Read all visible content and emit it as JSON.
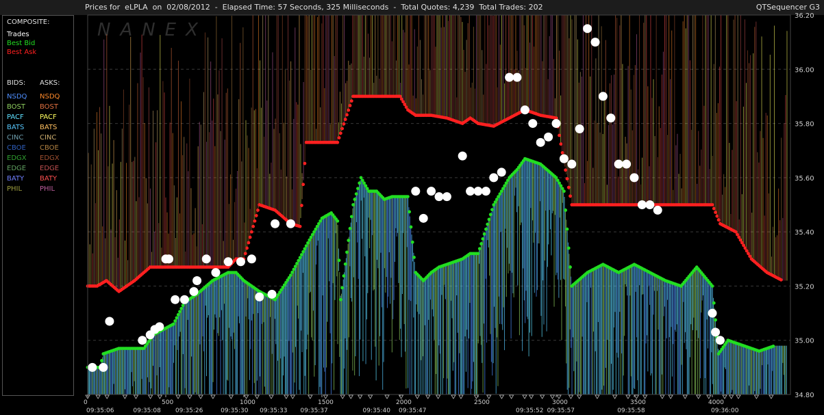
{
  "header": {
    "title": "Prices for  eLPLA  on  02/08/2012  -  Elapsed Time: 57 Seconds, 325 Milliseconds  -  Total Quotes: 4,239  Total Trades: 202",
    "app_name": "QTSequencer G3"
  },
  "watermark": "NANEX",
  "legend": {
    "composite_title": "COMPOSITE:",
    "composite": [
      {
        "label": "Trades",
        "color": "#ffffff"
      },
      {
        "label": "Best Bid",
        "color": "#22dd22"
      },
      {
        "label": "Best Ask",
        "color": "#ff2020"
      }
    ],
    "bids_title": "BIDS:",
    "asks_title": "ASKS:",
    "exchanges": [
      {
        "bid": "NSDQ",
        "ask": "NSDQ",
        "bid_color": "#4f8fff",
        "ask_color": "#ff8a2a"
      },
      {
        "bid": "BOST",
        "ask": "BOST",
        "bid_color": "#8fcf5f",
        "ask_color": "#e07040"
      },
      {
        "bid": "PACF",
        "ask": "PACF",
        "bid_color": "#5fe0ff",
        "ask_color": "#ffff60"
      },
      {
        "bid": "BATS",
        "ask": "BATS",
        "bid_color": "#58c8ff",
        "ask_color": "#ffc060"
      },
      {
        "bid": "CINC",
        "ask": "CINC",
        "bid_color": "#6fa0b0",
        "ask_color": "#d0b070"
      },
      {
        "bid": "CBOE",
        "ask": "CBOE",
        "bid_color": "#2f5fbf",
        "ask_color": "#b08040"
      },
      {
        "bid": "EDGX",
        "ask": "EDGX",
        "bid_color": "#30a030",
        "ask_color": "#a05030"
      },
      {
        "bid": "EDGE",
        "ask": "EDGE",
        "bid_color": "#60a060",
        "ask_color": "#c05050"
      },
      {
        "bid": "BATY",
        "ask": "BATY",
        "bid_color": "#7080ff",
        "ask_color": "#ff5050"
      },
      {
        "bid": "PHIL",
        "ask": "PHIL",
        "bid_color": "#a0a040",
        "ask_color": "#c060a0"
      }
    ]
  },
  "chart_data": {
    "type": "line",
    "ylim": [
      34.8,
      36.2
    ],
    "xlim": [
      0,
      4500
    ],
    "y_ticks": [
      "34.80",
      "35.00",
      "35.20",
      "35.40",
      "35.60",
      "35.80",
      "36.00",
      "36.20"
    ],
    "x_ticks": [
      0,
      500,
      1000,
      1500,
      2000,
      2500,
      3000,
      3500,
      4000
    ],
    "time_labels": [
      {
        "x": 0,
        "label": "09:35:06"
      },
      {
        "x": 300,
        "label": "09:35:08"
      },
      {
        "x": 570,
        "label": "09:35:26"
      },
      {
        "x": 860,
        "label": "09:35:30"
      },
      {
        "x": 1110,
        "label": "09:35:33"
      },
      {
        "x": 1370,
        "label": "09:35:37"
      },
      {
        "x": 1770,
        "label": "09:35:40"
      },
      {
        "x": 2000,
        "label": "09:35:47"
      },
      {
        "x": 2750,
        "label": "09:35:52"
      },
      {
        "x": 2950,
        "label": "09:35:57"
      },
      {
        "x": 3400,
        "label": "09:35:58"
      },
      {
        "x": 4000,
        "label": "09:36:00"
      }
    ],
    "series": [
      {
        "name": "Best Bid",
        "color": "#22dd22",
        "points": [
          [
            0,
            34.9
          ],
          [
            80,
            34.9
          ],
          [
            100,
            34.95
          ],
          [
            200,
            34.97
          ],
          [
            360,
            34.97
          ],
          [
            420,
            35.02
          ],
          [
            550,
            35.06
          ],
          [
            620,
            35.14
          ],
          [
            700,
            35.17
          ],
          [
            800,
            35.22
          ],
          [
            900,
            35.25
          ],
          [
            950,
            35.25
          ],
          [
            1000,
            35.22
          ],
          [
            1050,
            35.2
          ],
          [
            1100,
            35.18
          ],
          [
            1200,
            35.15
          ],
          [
            1300,
            35.24
          ],
          [
            1420,
            35.37
          ],
          [
            1500,
            35.45
          ],
          [
            1560,
            35.47
          ],
          [
            1600,
            35.44
          ],
          [
            1620,
            35.15
          ],
          [
            1700,
            35.5
          ],
          [
            1750,
            35.6
          ],
          [
            1800,
            35.55
          ],
          [
            1850,
            35.55
          ],
          [
            1900,
            35.52
          ],
          [
            1950,
            35.53
          ],
          [
            2000,
            35.53
          ],
          [
            2050,
            35.53
          ],
          [
            2100,
            35.25
          ],
          [
            2150,
            35.22
          ],
          [
            2200,
            35.25
          ],
          [
            2250,
            35.27
          ],
          [
            2300,
            35.28
          ],
          [
            2400,
            35.3
          ],
          [
            2450,
            35.32
          ],
          [
            2500,
            35.32
          ],
          [
            2600,
            35.5
          ],
          [
            2650,
            35.55
          ],
          [
            2700,
            35.6
          ],
          [
            2750,
            35.63
          ],
          [
            2800,
            35.67
          ],
          [
            2900,
            35.65
          ],
          [
            3000,
            35.6
          ],
          [
            3050,
            35.55
          ],
          [
            3100,
            35.2
          ],
          [
            3200,
            35.25
          ],
          [
            3300,
            35.28
          ],
          [
            3400,
            35.25
          ],
          [
            3500,
            35.28
          ],
          [
            3600,
            35.25
          ],
          [
            3700,
            35.22
          ],
          [
            3800,
            35.2
          ],
          [
            3900,
            35.27
          ],
          [
            4000,
            35.2
          ],
          [
            4040,
            34.95
          ],
          [
            4100,
            35.0
          ],
          [
            4200,
            34.98
          ],
          [
            4300,
            34.96
          ],
          [
            4400,
            34.98
          ]
        ]
      },
      {
        "name": "Best Ask",
        "color": "#ff2020",
        "points": [
          [
            0,
            35.2
          ],
          [
            60,
            35.2
          ],
          [
            120,
            35.22
          ],
          [
            200,
            35.18
          ],
          [
            300,
            35.22
          ],
          [
            400,
            35.27
          ],
          [
            500,
            35.27
          ],
          [
            600,
            35.27
          ],
          [
            700,
            35.27
          ],
          [
            800,
            35.27
          ],
          [
            900,
            35.27
          ],
          [
            950,
            35.3
          ],
          [
            1000,
            35.3
          ],
          [
            1050,
            35.4
          ],
          [
            1100,
            35.5
          ],
          [
            1200,
            35.48
          ],
          [
            1300,
            35.43
          ],
          [
            1360,
            35.42
          ],
          [
            1400,
            35.73
          ],
          [
            1500,
            35.73
          ],
          [
            1600,
            35.73
          ],
          [
            1700,
            35.9
          ],
          [
            1800,
            35.9
          ],
          [
            1900,
            35.9
          ],
          [
            2000,
            35.9
          ],
          [
            2050,
            35.85
          ],
          [
            2100,
            35.83
          ],
          [
            2200,
            35.83
          ],
          [
            2300,
            35.82
          ],
          [
            2400,
            35.8
          ],
          [
            2450,
            35.82
          ],
          [
            2500,
            35.8
          ],
          [
            2600,
            35.79
          ],
          [
            2700,
            35.82
          ],
          [
            2800,
            35.85
          ],
          [
            2900,
            35.83
          ],
          [
            3000,
            35.82
          ],
          [
            3100,
            35.5
          ],
          [
            3200,
            35.5
          ],
          [
            3400,
            35.5
          ],
          [
            3600,
            35.5
          ],
          [
            3800,
            35.5
          ],
          [
            4000,
            35.5
          ],
          [
            4050,
            35.43
          ],
          [
            4150,
            35.4
          ],
          [
            4250,
            35.3
          ],
          [
            4350,
            35.25
          ],
          [
            4450,
            35.22
          ]
        ]
      },
      {
        "name": "Trades",
        "color": "#ffffff",
        "points": [
          [
            30,
            34.9
          ],
          [
            100,
            34.9
          ],
          [
            140,
            35.07
          ],
          [
            350,
            35.0
          ],
          [
            400,
            35.02
          ],
          [
            430,
            35.04
          ],
          [
            460,
            35.05
          ],
          [
            500,
            35.3
          ],
          [
            520,
            35.3
          ],
          [
            560,
            35.15
          ],
          [
            620,
            35.15
          ],
          [
            680,
            35.18
          ],
          [
            700,
            35.22
          ],
          [
            760,
            35.3
          ],
          [
            820,
            35.25
          ],
          [
            900,
            35.29
          ],
          [
            980,
            35.29
          ],
          [
            1050,
            35.3
          ],
          [
            1100,
            35.16
          ],
          [
            1180,
            35.17
          ],
          [
            1200,
            35.43
          ],
          [
            1300,
            35.43
          ],
          [
            2100,
            35.55
          ],
          [
            2150,
            35.45
          ],
          [
            2200,
            35.55
          ],
          [
            2250,
            35.53
          ],
          [
            2300,
            35.53
          ],
          [
            2400,
            35.68
          ],
          [
            2450,
            35.55
          ],
          [
            2500,
            35.55
          ],
          [
            2550,
            35.55
          ],
          [
            2600,
            35.6
          ],
          [
            2650,
            35.62
          ],
          [
            2700,
            35.97
          ],
          [
            2750,
            35.97
          ],
          [
            2800,
            35.85
          ],
          [
            2850,
            35.8
          ],
          [
            2900,
            35.73
          ],
          [
            2950,
            35.75
          ],
          [
            3000,
            35.8
          ],
          [
            3050,
            35.67
          ],
          [
            3100,
            35.65
          ],
          [
            3150,
            35.78
          ],
          [
            3200,
            36.15
          ],
          [
            3250,
            36.1
          ],
          [
            3300,
            35.9
          ],
          [
            3350,
            35.82
          ],
          [
            3400,
            35.65
          ],
          [
            3450,
            35.65
          ],
          [
            3500,
            35.6
          ],
          [
            3550,
            35.5
          ],
          [
            3600,
            35.5
          ],
          [
            3650,
            35.48
          ],
          [
            4000,
            35.1
          ],
          [
            4020,
            35.03
          ],
          [
            4050,
            35.0
          ]
        ]
      }
    ]
  }
}
